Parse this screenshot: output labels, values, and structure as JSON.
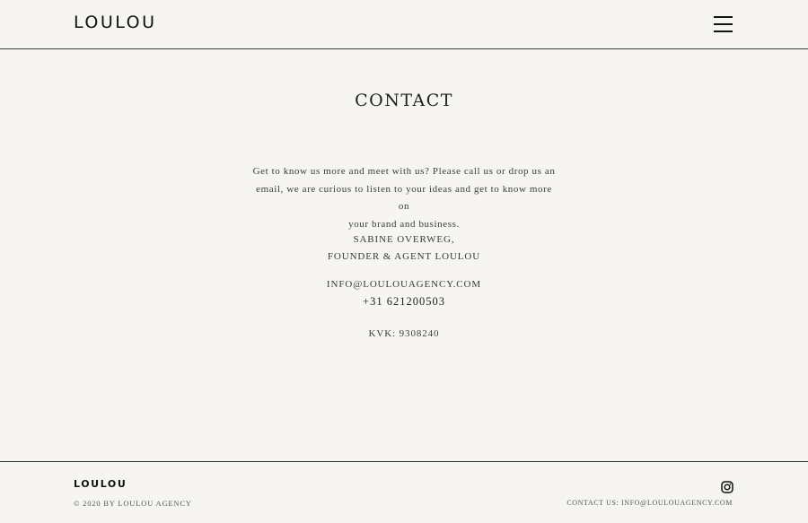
{
  "header": {
    "logo": "LOULOU",
    "menu_icon": "hamburger-menu-icon"
  },
  "main": {
    "title": "CONTACT",
    "intro_lines": [
      "Get to know us more and meet with us? Please call us or drop us an",
      "email, we are curious to listen to your ideas and get to know more on",
      "your brand and business."
    ],
    "person_name": "SABINE OVERWEG,",
    "person_role": "FOUNDER & AGENT LOULOU",
    "email": "INFO@LOULOUAGENCY.COM",
    "phone": "+31 621200503",
    "kvk": "KVK: 9308240"
  },
  "footer": {
    "logo": "LOULOU",
    "copyright": "© 2020 BY LOULOU AGENCY",
    "instagram_icon": "instagram-icon",
    "contact_text": "CONTACT US: INFO@LOULOUAGENCY.COM"
  },
  "colors": {
    "background": "#f6f5f1",
    "text": "#2b2b2b",
    "rule": "#3a3a3a"
  }
}
